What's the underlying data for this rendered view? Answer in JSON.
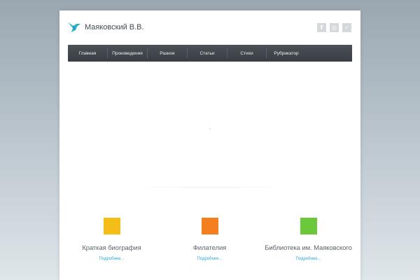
{
  "header": {
    "site_title": "Маяковский В.В.",
    "logo_icon": "bird-icon",
    "accent_color": "#2bb5c8",
    "social": [
      {
        "icon": "facebook-icon",
        "glyph": "f"
      },
      {
        "icon": "instagram-icon",
        "glyph": "◎"
      },
      {
        "icon": "twitter-icon",
        "glyph": "✓"
      }
    ]
  },
  "nav": {
    "items": [
      {
        "label": "Главная"
      },
      {
        "label": "Произведения"
      },
      {
        "label": "Разное"
      },
      {
        "label": "Статьи"
      },
      {
        "label": "Стихи"
      },
      {
        "label": "Рубрикатор"
      }
    ]
  },
  "features": [
    {
      "title": "Краткая биография",
      "link": "Подробнее...",
      "color": "#f5bd17"
    },
    {
      "title": "Филателия",
      "link": "Подробнее...",
      "color": "#f47f20"
    },
    {
      "title": "Библиотека им. Маяковского",
      "link": "Подробнее...",
      "color": "#6cc83b"
    }
  ]
}
